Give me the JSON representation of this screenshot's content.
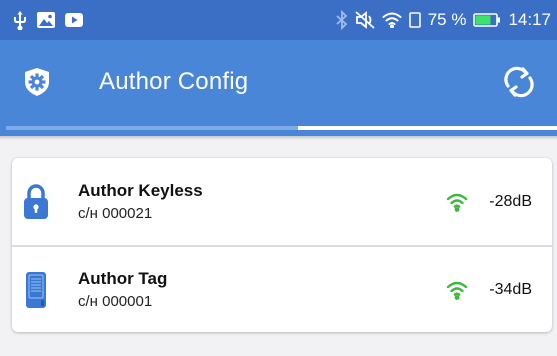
{
  "status_bar": {
    "left_icons": [
      "usb-icon",
      "image-icon",
      "youtube-icon"
    ],
    "right_icons": [
      "bluetooth-icon",
      "mute-icon",
      "wifi-icon",
      "battery-icon"
    ],
    "battery_percent": "75 %",
    "battery_level": 0.75,
    "time": "14:17"
  },
  "app_bar": {
    "logo_icon": "gear-shield-icon",
    "title": "Author Config",
    "action_icon": "refresh-icon"
  },
  "progress": {
    "fill_start": 0.53,
    "fill_end": 1.0
  },
  "colors": {
    "status_bar": "#3b6fc6",
    "app_bar": "#4a86d8",
    "device_icon": "#3a78d4",
    "signal": "#3bb83b"
  },
  "devices": [
    {
      "name": "Author Keyless",
      "serial": "с/н 000021",
      "rssi": "-28dB",
      "icon": "padlock-icon",
      "signal_icon": "wifi-signal-icon"
    },
    {
      "name": "Author Tag",
      "serial": "с/н 000001",
      "rssi": "-34dB",
      "icon": "tag-card-icon",
      "signal_icon": "wifi-signal-icon"
    }
  ]
}
